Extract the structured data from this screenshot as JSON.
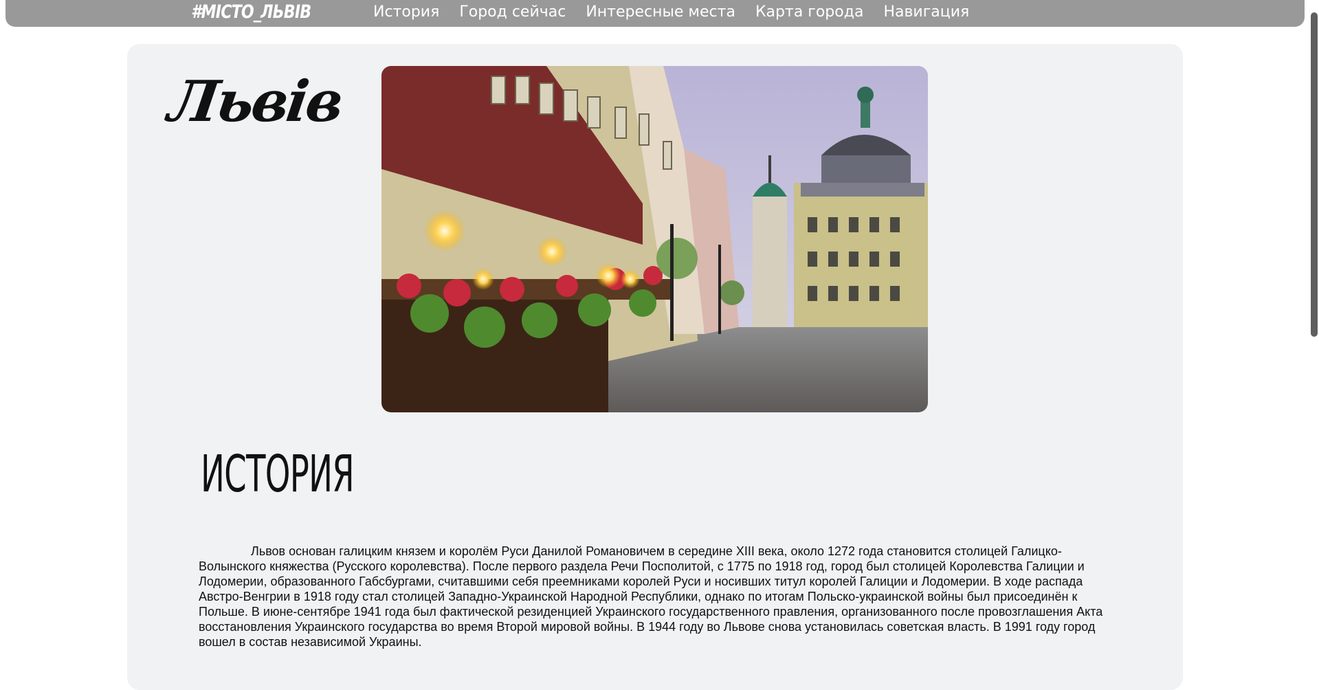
{
  "nav": {
    "logo": "#МІСТО_ЛЬВІВ",
    "links": [
      "История",
      "Город сейчас",
      "Интересные места",
      "Карта города",
      "Навигация"
    ]
  },
  "hero": {
    "city_name": "Львів",
    "image_icon": "city-square-photo"
  },
  "history": {
    "title": "ИСТОРИЯ",
    "text": "Львов основан галицким князем и королём Руси Данилой Романовичем в середине XIII века, около 1272 года становится столицей Галицко-Волынского княжества (Русского королевства). После первого раздела Речи Посполитой, с 1775 по 1918 год, город был столицей Королевства Галиции и Лодомерии, образованного Габсбургами, считавшими себя преемниками королей Руси и носивших титул королей Галиции и Лодомерии. В ходе распада Австро-Венгрии в 1918 году стал столицей Западно-Украинской Народной Республики, однако по итогам Польско-украинской войны был присоединён к Польше. В июне-сентябре 1941 года был фактической резиденцией Украинского государственного правления, организованного после провозглашения Акта восстановления Украинского государства во время Второй мировой войны. В 1944 году во Львове снова установилась советская власть. В 1991 году город вошел в состав независимой Украины."
  },
  "colors": {
    "navbar": "#999999",
    "card": "#f1f2f4",
    "text": "#111111"
  }
}
